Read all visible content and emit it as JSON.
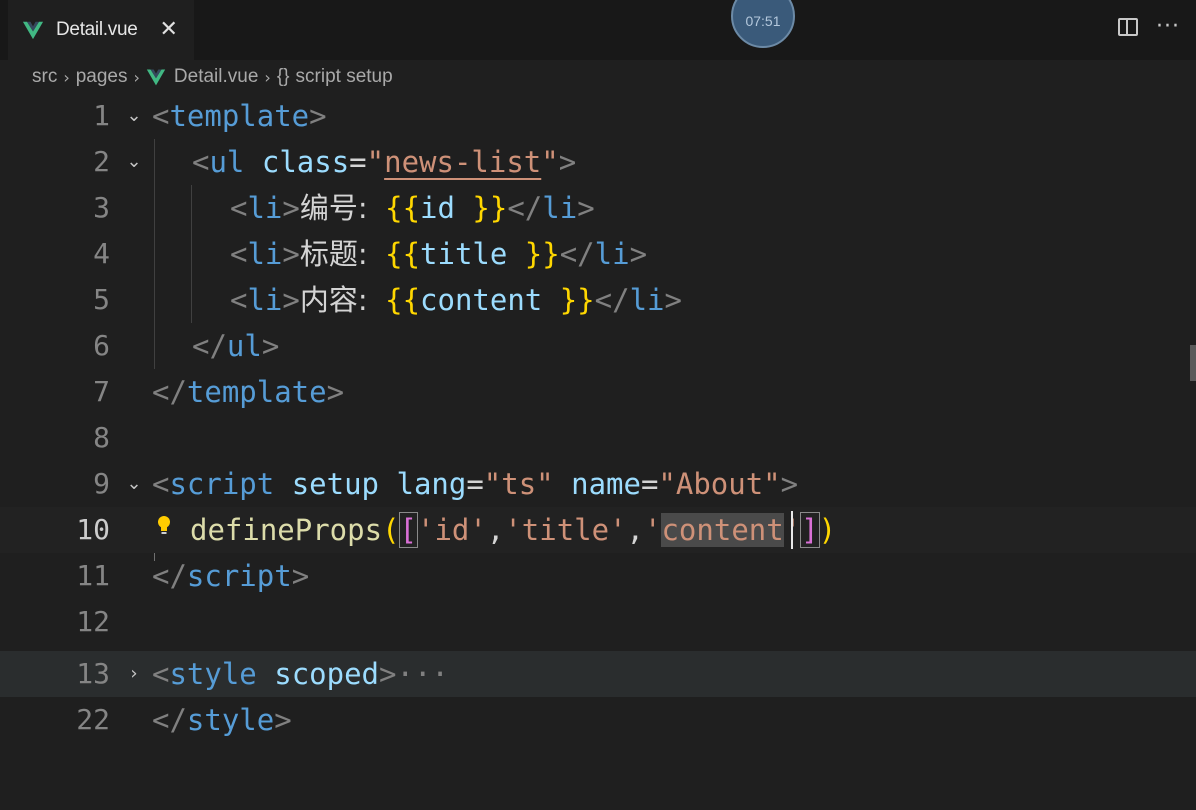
{
  "tab": {
    "title": "Detail.vue",
    "close_glyph": "✕",
    "icon": "vue-icon"
  },
  "timer": {
    "text": "07:51"
  },
  "header_actions": {
    "split_icon": "split-editor-icon",
    "more_glyph": "···"
  },
  "breadcrumb": {
    "items": [
      "src",
      "pages",
      "Detail.vue",
      "script setup"
    ],
    "separator": "›",
    "braces_glyph": "{}"
  },
  "editor": {
    "current_line": 10,
    "lines": [
      {
        "n": "1",
        "fold": "⌄"
      },
      {
        "n": "2",
        "fold": "⌄"
      },
      {
        "n": "3",
        "fold": ""
      },
      {
        "n": "4",
        "fold": ""
      },
      {
        "n": "5",
        "fold": ""
      },
      {
        "n": "6",
        "fold": ""
      },
      {
        "n": "7",
        "fold": ""
      },
      {
        "n": "8",
        "fold": ""
      },
      {
        "n": "9",
        "fold": "⌄"
      },
      {
        "n": "10",
        "fold": ""
      },
      {
        "n": "11",
        "fold": ""
      },
      {
        "n": "12",
        "fold": ""
      },
      {
        "n": "13",
        "fold": "›"
      },
      {
        "n": "22",
        "fold": ""
      }
    ],
    "code": {
      "l1": {
        "lt": "<",
        "tag": "template",
        "gt": ">"
      },
      "l2": {
        "lt": "<",
        "tag": "ul",
        "attr": "class",
        "eq": "=",
        "q1": "\"",
        "val": "news-list",
        "q2": "\"",
        "gt": ">"
      },
      "l3": {
        "lt": "<",
        "tag": "li",
        "gt": ">",
        "label": "编号:",
        "open": "{{",
        "expr": "id ",
        "close": "}}",
        "end_lt": "</",
        "end_tag": "li",
        "end_gt": ">"
      },
      "l4": {
        "lt": "<",
        "tag": "li",
        "gt": ">",
        "label": "标题:",
        "open": "{{",
        "expr": "title ",
        "close": "}}",
        "end_lt": "</",
        "end_tag": "li",
        "end_gt": ">"
      },
      "l5": {
        "lt": "<",
        "tag": "li",
        "gt": ">",
        "label": "内容:",
        "open": "{{",
        "expr": "content ",
        "close": "}}",
        "end_lt": "</",
        "end_tag": "li",
        "end_gt": ">"
      },
      "l6": {
        "lt": "</",
        "tag": "ul",
        "gt": ">"
      },
      "l7": {
        "lt": "</",
        "tag": "template",
        "gt": ">"
      },
      "l9": {
        "lt": "<",
        "tag": "script",
        "a1": "setup",
        "a2": "lang",
        "eq": "=",
        "v2": "\"ts\"",
        "a3": "name",
        "v3": "\"About\"",
        "gt": ">"
      },
      "l10": {
        "fn": "defineProps",
        "p_open": "(",
        "b_open": "[",
        "s1": "'id'",
        "comma": ",",
        "s2": "'title'",
        "s3a": "'",
        "s3sel1": "cont",
        "s3sel2": "ent",
        "s3b": "'",
        "b_close": "]",
        "p_close": ")"
      },
      "l11": {
        "lt": "</",
        "tag": "script",
        "gt": ">"
      },
      "l13": {
        "lt": "<",
        "tag": "style",
        "attr": "scoped",
        "gt": ">",
        "ellipsis": "···"
      },
      "l22": {
        "lt": "</",
        "tag": "style",
        "gt": ">"
      }
    }
  }
}
